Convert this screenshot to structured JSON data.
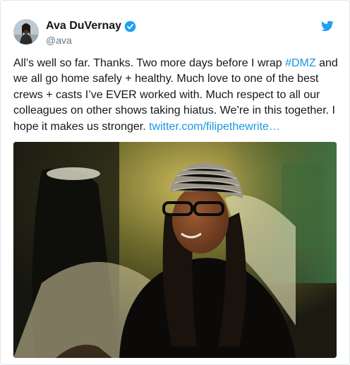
{
  "tweet": {
    "author_name": "Ava DuVernay",
    "handle": "@ava",
    "text_before_hashtag": "All’s well so far. Thanks. Two more days before I wrap ",
    "hashtag": "#DMZ",
    "text_after_hashtag": " and we all go home safely + healthy. Much love to one of the best crews + casts I’ve EVER worked with. Much respect to all our colleagues on other shows taking hiatus. We’re in this together. I hope it makes us stronger. ",
    "link_text": "twitter.com/filipethewrite…"
  },
  "icons": {
    "verified": "verified-badge-icon",
    "bird": "twitter-bird-icon"
  },
  "colors": {
    "link": "#1b95e0",
    "verified": "#1da1f2",
    "text": "#14171a",
    "secondary": "#657786"
  }
}
